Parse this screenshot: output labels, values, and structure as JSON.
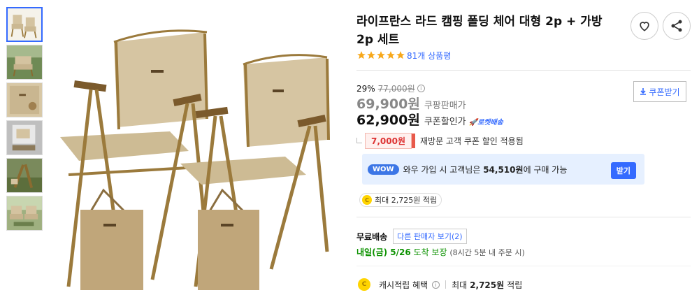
{
  "product": {
    "title": "라이프란스 라드 캠핑 폴딩 체어 대형 2p + 가방 2p 세트",
    "review_count": "81개 상품평",
    "discount_rate": "29%",
    "original_price": "77,000원",
    "coupang_price": "69,900원",
    "coupang_price_label": "쿠팡판매가",
    "coupon_price": "62,900원",
    "coupon_price_label": "쿠폰할인가",
    "rocket_label": "로켓배송",
    "coupon_button": "쿠폰받기",
    "revisit_coupon_amount": "7,000원",
    "revisit_coupon_text": "재방문 고객 쿠폰 할인 적용됨",
    "rating_fraction": 1.0
  },
  "wow": {
    "badge": "WOW",
    "text_prefix": "와우 가입 시 고객님은",
    "price": "54,510원",
    "text_suffix": "에 구매 가능",
    "button": "받기"
  },
  "points": {
    "coin_label": "C",
    "text": "최대 2,725원 적립"
  },
  "shipping": {
    "free": "무료배송",
    "other_sellers": "다른 판매자 보기(2)",
    "arrival_day": "내일(금) 5/26",
    "arrival_suffix": "도착 보장",
    "arrival_note": "(8시간 5분 내 주문 시)"
  },
  "cash": {
    "coin_label": "C",
    "label": "캐시적립 혜택",
    "max_label": "최대",
    "amount": "2,725원",
    "suffix": "적립"
  },
  "colors": {
    "accent": "#346aff",
    "chair": "#d4c3a0",
    "frame": "#9b7a3c",
    "bag": "#c2a77a",
    "green": "#0c9200"
  }
}
